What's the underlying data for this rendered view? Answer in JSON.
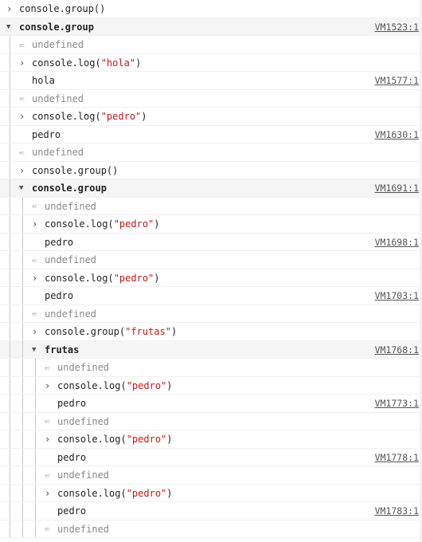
{
  "console": {
    "rows": [
      {
        "kind": "command",
        "depth": 0,
        "parts": [
          {
            "t": "console.group()"
          }
        ]
      },
      {
        "kind": "grouphead",
        "depth": 0,
        "label": "console.group",
        "source": "VM1523:1"
      },
      {
        "kind": "result",
        "depth": 1,
        "text": "undefined"
      },
      {
        "kind": "command",
        "depth": 1,
        "parts": [
          {
            "t": "console.log("
          },
          {
            "t": "\"hola\"",
            "s": true
          },
          {
            "t": ")"
          }
        ]
      },
      {
        "kind": "log",
        "depth": 1,
        "text": "hola",
        "source": "VM1577:1"
      },
      {
        "kind": "result",
        "depth": 1,
        "text": "undefined"
      },
      {
        "kind": "command",
        "depth": 1,
        "parts": [
          {
            "t": "console.log("
          },
          {
            "t": "\"pedro\"",
            "s": true
          },
          {
            "t": ")"
          }
        ]
      },
      {
        "kind": "log",
        "depth": 1,
        "text": "pedro",
        "source": "VM1630:1"
      },
      {
        "kind": "result",
        "depth": 1,
        "text": "undefined"
      },
      {
        "kind": "command",
        "depth": 1,
        "parts": [
          {
            "t": "console.group()"
          }
        ]
      },
      {
        "kind": "grouphead",
        "depth": 1,
        "label": "console.group",
        "source": "VM1691:1"
      },
      {
        "kind": "result",
        "depth": 2,
        "text": "undefined"
      },
      {
        "kind": "command",
        "depth": 2,
        "parts": [
          {
            "t": "console.log("
          },
          {
            "t": "\"pedro\"",
            "s": true
          },
          {
            "t": ")"
          }
        ]
      },
      {
        "kind": "log",
        "depth": 2,
        "text": "pedro",
        "source": "VM1698:1"
      },
      {
        "kind": "result",
        "depth": 2,
        "text": "undefined"
      },
      {
        "kind": "command",
        "depth": 2,
        "parts": [
          {
            "t": "console.log("
          },
          {
            "t": "\"pedro\"",
            "s": true
          },
          {
            "t": ")"
          }
        ]
      },
      {
        "kind": "log",
        "depth": 2,
        "text": "pedro",
        "source": "VM1703:1"
      },
      {
        "kind": "result",
        "depth": 2,
        "text": "undefined"
      },
      {
        "kind": "command",
        "depth": 2,
        "parts": [
          {
            "t": "console.group("
          },
          {
            "t": "\"frutas\"",
            "s": true
          },
          {
            "t": ")"
          }
        ]
      },
      {
        "kind": "grouphead",
        "depth": 2,
        "label": "frutas",
        "source": "VM1768:1"
      },
      {
        "kind": "result",
        "depth": 3,
        "text": "undefined"
      },
      {
        "kind": "command",
        "depth": 3,
        "parts": [
          {
            "t": "console.log("
          },
          {
            "t": "\"pedro\"",
            "s": true
          },
          {
            "t": ")"
          }
        ]
      },
      {
        "kind": "log",
        "depth": 3,
        "text": "pedro",
        "source": "VM1773:1"
      },
      {
        "kind": "result",
        "depth": 3,
        "text": "undefined"
      },
      {
        "kind": "command",
        "depth": 3,
        "parts": [
          {
            "t": "console.log("
          },
          {
            "t": "\"pedro\"",
            "s": true
          },
          {
            "t": ")"
          }
        ]
      },
      {
        "kind": "log",
        "depth": 3,
        "text": "pedro",
        "source": "VM1778:1"
      },
      {
        "kind": "result",
        "depth": 3,
        "text": "undefined"
      },
      {
        "kind": "command",
        "depth": 3,
        "parts": [
          {
            "t": "console.log("
          },
          {
            "t": "\"pedro\"",
            "s": true
          },
          {
            "t": ")"
          }
        ]
      },
      {
        "kind": "log",
        "depth": 3,
        "text": "pedro",
        "source": "VM1783:1"
      },
      {
        "kind": "result",
        "depth": 3,
        "text": "undefined"
      }
    ]
  },
  "icons": {
    "command": "chevron-right-icon",
    "grouphead": "caret-down-icon",
    "result": "return-arrow-icon"
  },
  "colors": {
    "string": "#c41a16",
    "undefined": "#8a8a8a",
    "group_header_bg": "#f5f5f5",
    "guide_line": "#c9c9c9"
  }
}
